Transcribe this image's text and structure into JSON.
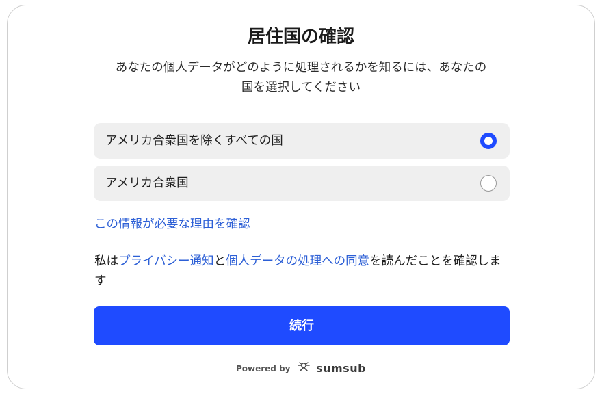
{
  "title": "居住国の確認",
  "subtitle_line1": "あなたの個人データがどのように処理されるかを知るには、あなたの",
  "subtitle_line2": "国を選択してください",
  "options": [
    {
      "label": "アメリカ合衆国を除くすべての国",
      "selected": true
    },
    {
      "label": "アメリカ合衆国",
      "selected": false
    }
  ],
  "why_link": "この情報が必要な理由を確認",
  "consent": {
    "prefix": "私は",
    "privacy_link": "プライバシー通知",
    "and": "と",
    "processing_link": "個人データの処理への同意",
    "suffix": "を読んだことを確認します"
  },
  "continue_label": "続行",
  "footer": {
    "powered_by": "Powered by",
    "brand": "sumsub",
    "icon": "sumsub-logo-icon"
  },
  "colors": {
    "accent": "#1f4bff",
    "link": "#2c5fd6",
    "option_bg": "#efefef"
  }
}
